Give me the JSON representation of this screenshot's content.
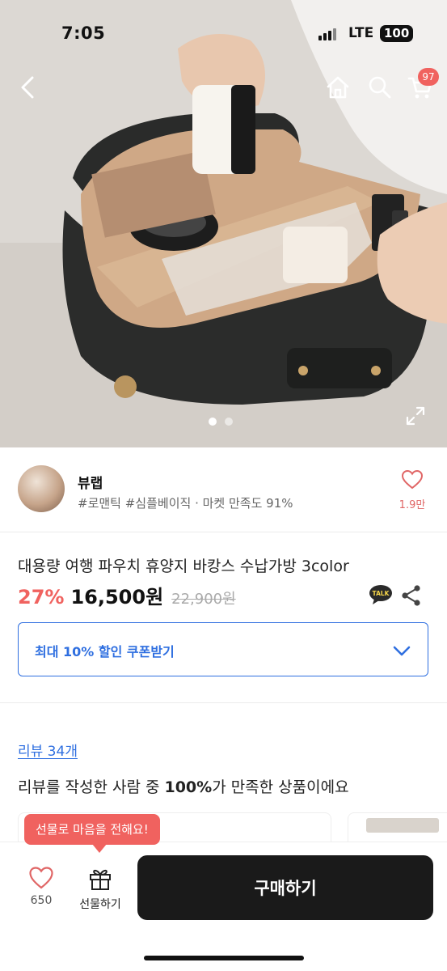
{
  "status_bar": {
    "time": "7:05",
    "network": "LTE",
    "battery": "100"
  },
  "nav": {
    "cart_count": "97"
  },
  "carousel": {
    "total": 2,
    "active": 1
  },
  "seller": {
    "name": "뷰랩",
    "tags": "#로맨틱 #심플베이직 · 마켓 만족도 91%",
    "like_count": "1.9만"
  },
  "product": {
    "title": "대용량 여행 파우치 휴양지 바캉스 수납가방 3color",
    "discount": "27%",
    "price": "16,500원",
    "original_price": "22,900원"
  },
  "coupon": {
    "label": "최대 10% 할인 쿠폰받기"
  },
  "reviews": {
    "link": "리뷰 34개",
    "summary_prefix": "리뷰를 작성한 사람 중 ",
    "summary_bold": "100%",
    "summary_suffix": "가 만족한 상품이에요"
  },
  "bottom_bar": {
    "tooltip": "선물로 마음을 전해요!",
    "wish_count": "650",
    "gift_label": "선물하기",
    "buy_label": "구매하기"
  },
  "colors": {
    "accent_red": "#f0625f",
    "accent_blue": "#2f6fe0",
    "buy_button": "#1a1a1a"
  },
  "icons": [
    "back-arrow-icon",
    "home-icon",
    "search-icon",
    "cart-icon",
    "expand-icon",
    "heart-icon",
    "talk-icon",
    "share-icon",
    "chevron-down-icon",
    "gift-icon"
  ]
}
